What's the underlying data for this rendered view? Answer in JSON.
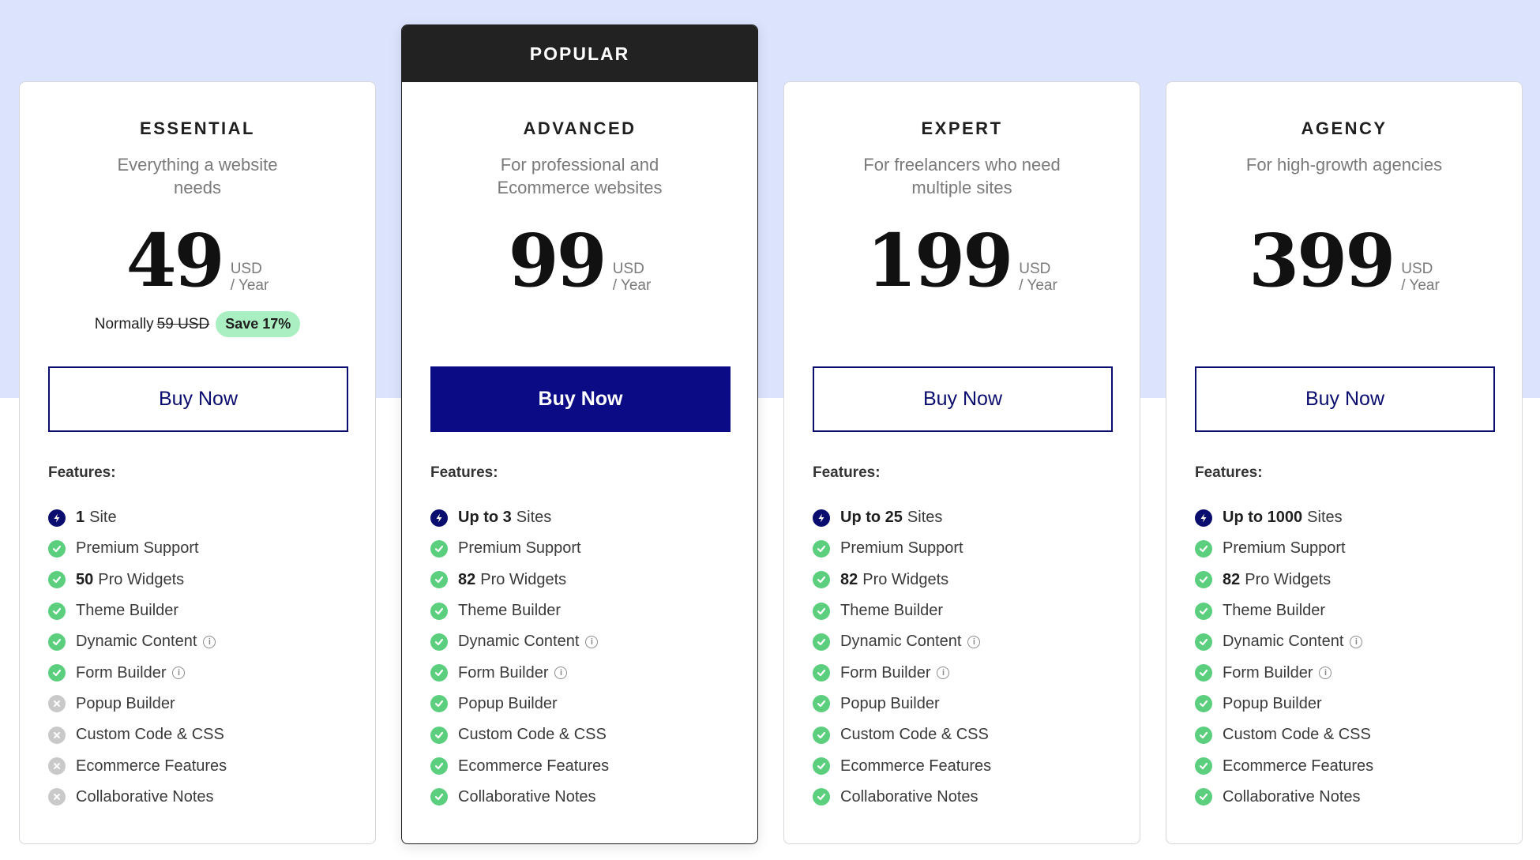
{
  "plans": [
    {
      "name": "ESSENTIAL",
      "desc_line1": "Everything a website",
      "desc_line2": "needs",
      "price": "49",
      "currency": "USD",
      "period": "/ Year",
      "normally_label": "Normally",
      "normally_price": "59 USD",
      "save_badge": "Save 17%",
      "buy_label": "Buy Now",
      "features_label": "Features:",
      "features": [
        {
          "icon": "bolt-icon",
          "strong": "1",
          "text": "Site",
          "info": false
        },
        {
          "icon": "check-icon",
          "strong": "",
          "text": "Premium Support",
          "info": false
        },
        {
          "icon": "check-icon",
          "strong": "50",
          "text": "Pro Widgets",
          "info": false
        },
        {
          "icon": "check-icon",
          "strong": "",
          "text": "Theme Builder",
          "info": false
        },
        {
          "icon": "check-icon",
          "strong": "",
          "text": "Dynamic Content",
          "info": true
        },
        {
          "icon": "check-icon",
          "strong": "",
          "text": "Form Builder",
          "info": true
        },
        {
          "icon": "cross-icon",
          "strong": "",
          "text": "Popup Builder",
          "info": false
        },
        {
          "icon": "cross-icon",
          "strong": "",
          "text": "Custom Code & CSS",
          "info": false
        },
        {
          "icon": "cross-icon",
          "strong": "",
          "text": "Ecommerce Features",
          "info": false
        },
        {
          "icon": "cross-icon",
          "strong": "",
          "text": "Collaborative Notes",
          "info": false
        }
      ]
    },
    {
      "ribbon": "POPULAR",
      "name": "ADVANCED",
      "desc_line1": "For professional and",
      "desc_line2": "Ecommerce websites",
      "price": "99",
      "currency": "USD",
      "period": "/ Year",
      "buy_label": "Buy Now",
      "features_label": "Features:",
      "features": [
        {
          "icon": "bolt-icon",
          "strong": "Up to 3",
          "text": "Sites",
          "info": false
        },
        {
          "icon": "check-icon",
          "strong": "",
          "text": "Premium Support",
          "info": false
        },
        {
          "icon": "check-icon",
          "strong": "82",
          "text": "Pro Widgets",
          "info": false
        },
        {
          "icon": "check-icon",
          "strong": "",
          "text": "Theme Builder",
          "info": false
        },
        {
          "icon": "check-icon",
          "strong": "",
          "text": "Dynamic Content",
          "info": true
        },
        {
          "icon": "check-icon",
          "strong": "",
          "text": "Form Builder",
          "info": true
        },
        {
          "icon": "check-icon",
          "strong": "",
          "text": "Popup Builder",
          "info": false
        },
        {
          "icon": "check-icon",
          "strong": "",
          "text": "Custom Code & CSS",
          "info": false
        },
        {
          "icon": "check-icon",
          "strong": "",
          "text": "Ecommerce Features",
          "info": false
        },
        {
          "icon": "check-icon",
          "strong": "",
          "text": "Collaborative Notes",
          "info": false
        }
      ]
    },
    {
      "name": "EXPERT",
      "desc_line1": "For freelancers who need",
      "desc_line2": "multiple sites",
      "price": "199",
      "currency": "USD",
      "period": "/ Year",
      "buy_label": "Buy Now",
      "features_label": "Features:",
      "features": [
        {
          "icon": "bolt-icon",
          "strong": "Up to 25",
          "text": "Sites",
          "info": false
        },
        {
          "icon": "check-icon",
          "strong": "",
          "text": "Premium Support",
          "info": false
        },
        {
          "icon": "check-icon",
          "strong": "82",
          "text": "Pro Widgets",
          "info": false
        },
        {
          "icon": "check-icon",
          "strong": "",
          "text": "Theme Builder",
          "info": false
        },
        {
          "icon": "check-icon",
          "strong": "",
          "text": "Dynamic Content",
          "info": true
        },
        {
          "icon": "check-icon",
          "strong": "",
          "text": "Form Builder",
          "info": true
        },
        {
          "icon": "check-icon",
          "strong": "",
          "text": "Popup Builder",
          "info": false
        },
        {
          "icon": "check-icon",
          "strong": "",
          "text": "Custom Code & CSS",
          "info": false
        },
        {
          "icon": "check-icon",
          "strong": "",
          "text": "Ecommerce Features",
          "info": false
        },
        {
          "icon": "check-icon",
          "strong": "",
          "text": "Collaborative Notes",
          "info": false
        }
      ]
    },
    {
      "name": "AGENCY",
      "desc_line1": "For high-growth agencies",
      "desc_line2": "",
      "price": "399",
      "currency": "USD",
      "period": "/ Year",
      "buy_label": "Buy Now",
      "features_label": "Features:",
      "features": [
        {
          "icon": "bolt-icon",
          "strong": "Up to 1000",
          "text": "Sites",
          "info": false
        },
        {
          "icon": "check-icon",
          "strong": "",
          "text": "Premium Support",
          "info": false
        },
        {
          "icon": "check-icon",
          "strong": "82",
          "text": "Pro Widgets",
          "info": false
        },
        {
          "icon": "check-icon",
          "strong": "",
          "text": "Theme Builder",
          "info": false
        },
        {
          "icon": "check-icon",
          "strong": "",
          "text": "Dynamic Content",
          "info": true
        },
        {
          "icon": "check-icon",
          "strong": "",
          "text": "Form Builder",
          "info": true
        },
        {
          "icon": "check-icon",
          "strong": "",
          "text": "Popup Builder",
          "info": false
        },
        {
          "icon": "check-icon",
          "strong": "",
          "text": "Custom Code & CSS",
          "info": false
        },
        {
          "icon": "check-icon",
          "strong": "",
          "text": "Ecommerce Features",
          "info": false
        },
        {
          "icon": "check-icon",
          "strong": "",
          "text": "Collaborative Notes",
          "info": false
        }
      ]
    }
  ],
  "info_glyph": "i",
  "colors": {
    "hero_bg": "#dbe3fd",
    "brand_navy": "#0b0b85",
    "check_green": "#5ccf7e",
    "cross_gray": "#c9c9c9",
    "save_badge_bg": "#a9efc1",
    "ribbon_bg": "#222222"
  }
}
